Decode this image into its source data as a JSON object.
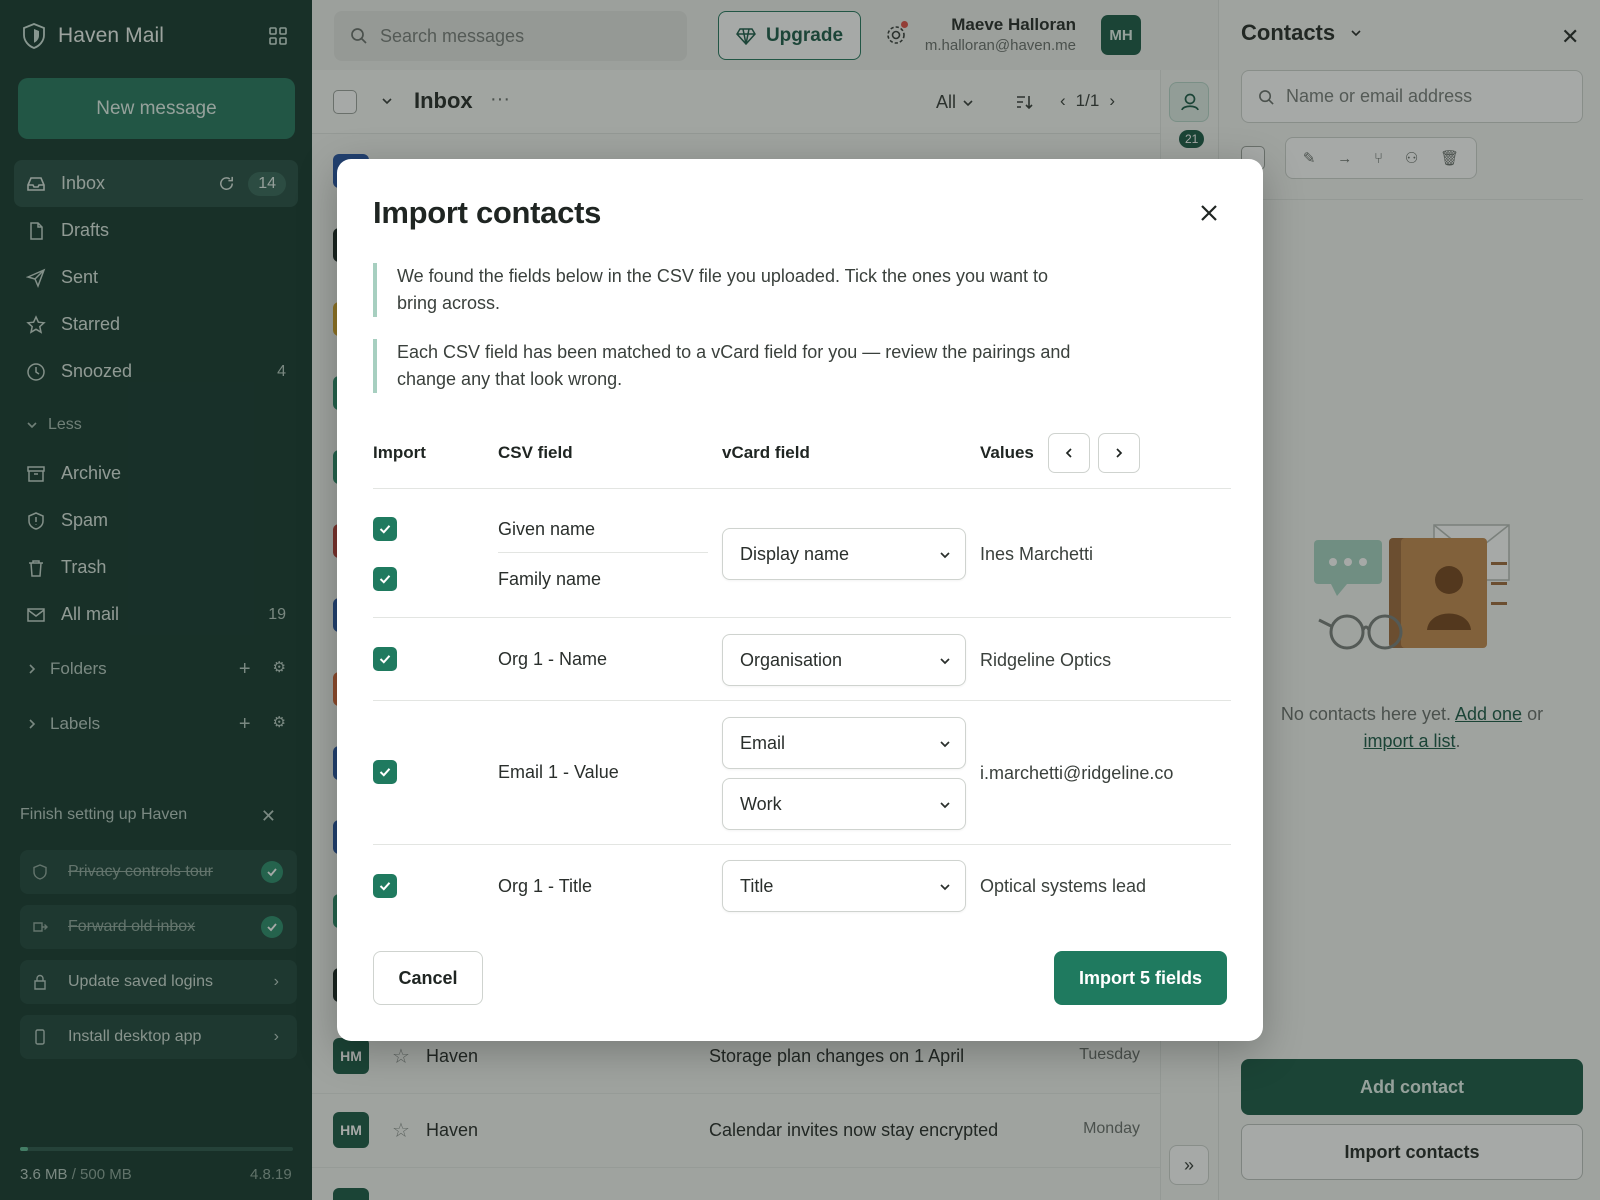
{
  "app": {
    "name": "Haven Mail"
  },
  "sidebar": {
    "new_message": "New message",
    "items": [
      {
        "label": "Inbox",
        "count": "14",
        "icon": "inbox-icon"
      },
      {
        "label": "Drafts",
        "count": "",
        "icon": "file-icon"
      },
      {
        "label": "Sent",
        "count": "",
        "icon": "send-icon"
      },
      {
        "label": "Starred",
        "count": "",
        "icon": "star-icon"
      },
      {
        "label": "Snoozed",
        "count": "4",
        "icon": "clock-icon"
      },
      {
        "label": "Archive",
        "count": "",
        "icon": "archive-icon"
      },
      {
        "label": "Spam",
        "count": "",
        "icon": "spam-icon"
      },
      {
        "label": "Trash",
        "count": "",
        "icon": "trash-icon"
      },
      {
        "label": "All mail",
        "count": "19",
        "icon": "mail-icon"
      }
    ],
    "less_label": "Less",
    "folders_label": "Folders",
    "labels_label": "Labels",
    "setup": {
      "title": "Finish setting up Haven",
      "tasks": [
        {
          "label": "Privacy controls tour",
          "done": true
        },
        {
          "label": "Forward old inbox",
          "done": true
        },
        {
          "label": "Update saved logins",
          "done": false
        },
        {
          "label": "Install desktop app",
          "done": false
        }
      ]
    },
    "storage": {
      "used": "3.6 MB",
      "total": "/ 500 MB",
      "used_fraction": 0.007
    },
    "version": "4.8.19"
  },
  "topbar": {
    "search_placeholder": "Search messages",
    "upgrade_label": "Upgrade",
    "user_name": "Maeve Halloran",
    "user_email": "m.halloran@haven.me",
    "user_initials": "MH"
  },
  "list": {
    "title": "Inbox",
    "more": "···",
    "filter": "All",
    "pager": "1/1",
    "calendar_badge": "21",
    "messages": [
      {
        "initials": "HM",
        "sender": "Haven",
        "subject": "Storage plan changes on 1 April",
        "date": "Tuesday"
      },
      {
        "initials": "HM",
        "sender": "Haven",
        "subject": "Calendar invites now stay encrypted",
        "date": "Monday"
      }
    ]
  },
  "contacts": {
    "title": "Contacts",
    "search_placeholder": "Name or email address",
    "empty_prefix": "No contacts here yet.",
    "empty_add": "Add one",
    "empty_or": "or",
    "empty_import": "import a list",
    "empty_period": ".",
    "add_button": "Add contact",
    "import_button": "Import contacts"
  },
  "modal": {
    "title": "Import contacts",
    "note_1": "We found the fields below in the CSV file you uploaded. Tick the ones you want to bring across.",
    "note_2": "Each CSV field has been matched to a vCard field for you — review the pairings and change any that look wrong.",
    "headers": {
      "import": "Import",
      "csv": "CSV field",
      "vcard": "vCard field",
      "values": "Values"
    },
    "rows": {
      "given_name": "Given name",
      "family_name": "Family name",
      "display_select": "Display name",
      "display_value": "Ines Marchetti",
      "org_name": "Org 1 - Name",
      "org_select": "Organisation",
      "org_value": "Ridgeline Optics",
      "email_field": "Email 1 - Value",
      "email_select": "Email",
      "email_type_select": "Work",
      "email_value": "i.marchetti@ridgeline.co",
      "title_field": "Org 1 - Title",
      "title_select": "Title",
      "title_value": "Optical systems lead"
    },
    "cancel": "Cancel",
    "import_button": "Import 5 fields"
  }
}
